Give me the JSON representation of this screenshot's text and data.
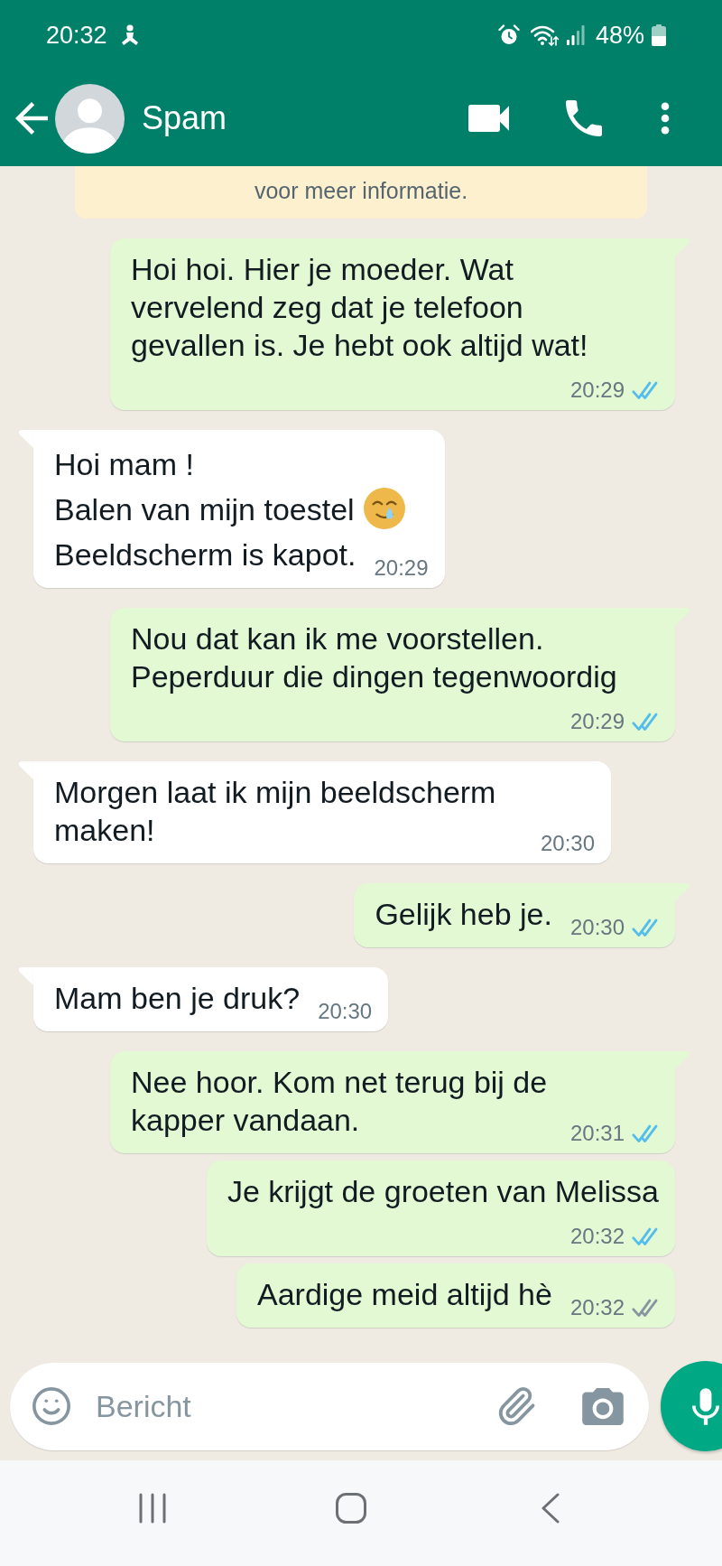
{
  "status_bar": {
    "time": "20:32",
    "battery": "48%"
  },
  "header": {
    "contact_name": "Spam"
  },
  "encryption_notice": {
    "text": "voor meer informatie."
  },
  "messages": [
    {
      "kind": "outgoing",
      "paragraphs": [
        {
          "text": "Hoi hoi. Hier je moeder. Wat\nvervelend zeg dat je telefoon\ngevallen is. Je hebt ook altijd wat!",
          "emoji": false
        }
      ],
      "time": "20:29",
      "read": true
    },
    {
      "kind": "incoming",
      "paragraphs": [
        {
          "text": "Hoi mam !",
          "emoji": false
        },
        {
          "text": "Balen van mijn toestel",
          "emoji": true
        },
        {
          "text": "Beeldscherm is kapot.",
          "emoji": false
        }
      ],
      "time": "20:29"
    },
    {
      "kind": "outgoing",
      "paragraphs": [
        {
          "text": "Nou dat kan ik me voorstellen.\nPeperduur die dingen tegenwoordig",
          "emoji": false
        }
      ],
      "time": "20:29",
      "read": true
    },
    {
      "kind": "incoming",
      "paragraphs": [
        {
          "text": "Morgen laat ik mijn beeldscherm\nmaken!",
          "emoji": false
        }
      ],
      "time": "20:30"
    },
    {
      "kind": "outgoing",
      "paragraphs": [
        {
          "text": "Gelijk heb je.",
          "emoji": false
        }
      ],
      "time": "20:30",
      "read": true
    },
    {
      "kind": "incoming",
      "paragraphs": [
        {
          "text": "Mam ben je druk?",
          "emoji": false
        }
      ],
      "time": "20:30"
    },
    {
      "kind": "outgoing",
      "paragraphs": [
        {
          "text": "Nee hoor. Kom net terug bij de\nkapper vandaan.",
          "emoji": false
        }
      ],
      "time": "20:31",
      "read": true
    },
    {
      "kind": "outgoing",
      "paragraphs": [
        {
          "text": "Je krijgt de groeten van Melissa",
          "emoji": false
        }
      ],
      "time": "20:32",
      "read": true
    },
    {
      "kind": "outgoing",
      "paragraphs": [
        {
          "text": "Aardige meid altijd hè",
          "emoji": false
        }
      ],
      "time": "20:32",
      "read": false
    }
  ],
  "composer": {
    "placeholder": "Bericht"
  }
}
